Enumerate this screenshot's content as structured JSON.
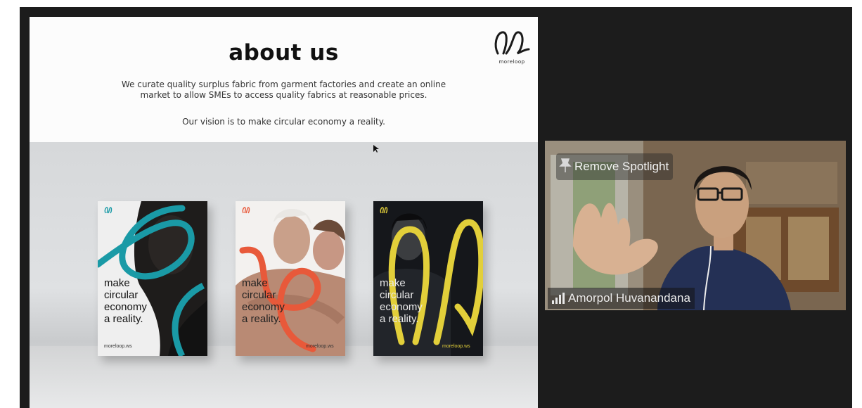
{
  "slide": {
    "title": "about us",
    "description_line1": "We curate quality surplus fabric from garment factories and create an online",
    "description_line2": "market to allow SMEs to access quality fabrics at reasonable prices.",
    "vision": "Our vision is to make circular economy a reality.",
    "logo_text": "moreloop",
    "posters": [
      {
        "lines": [
          "make",
          "circular",
          "economy",
          "a reality."
        ],
        "url": "moreloop.ws",
        "accent": "#1a9aa6",
        "bg": "#f2f2f2",
        "text_color": "#111111"
      },
      {
        "lines": [
          "make",
          "circular",
          "economy",
          "a reality."
        ],
        "url": "moreloop.ws",
        "accent": "#e8593a",
        "bg": "#f4f1ee",
        "text_color": "#222222"
      },
      {
        "lines": [
          "make",
          "circular",
          "economy",
          "a reality."
        ],
        "url": "moreloop.ws",
        "accent": "#e2cf3a",
        "bg": "#121418",
        "text_color": "#e9e9e9"
      }
    ]
  },
  "video": {
    "participant_name": "Amorpol Huvanandana",
    "spotlight_button": "Remove Spotlight"
  },
  "colors": {
    "meeting_background": "#1c1c1c",
    "teal_accent": "#1a9aa6",
    "orange_accent": "#e8593a",
    "yellow_accent": "#e2cf3a"
  }
}
